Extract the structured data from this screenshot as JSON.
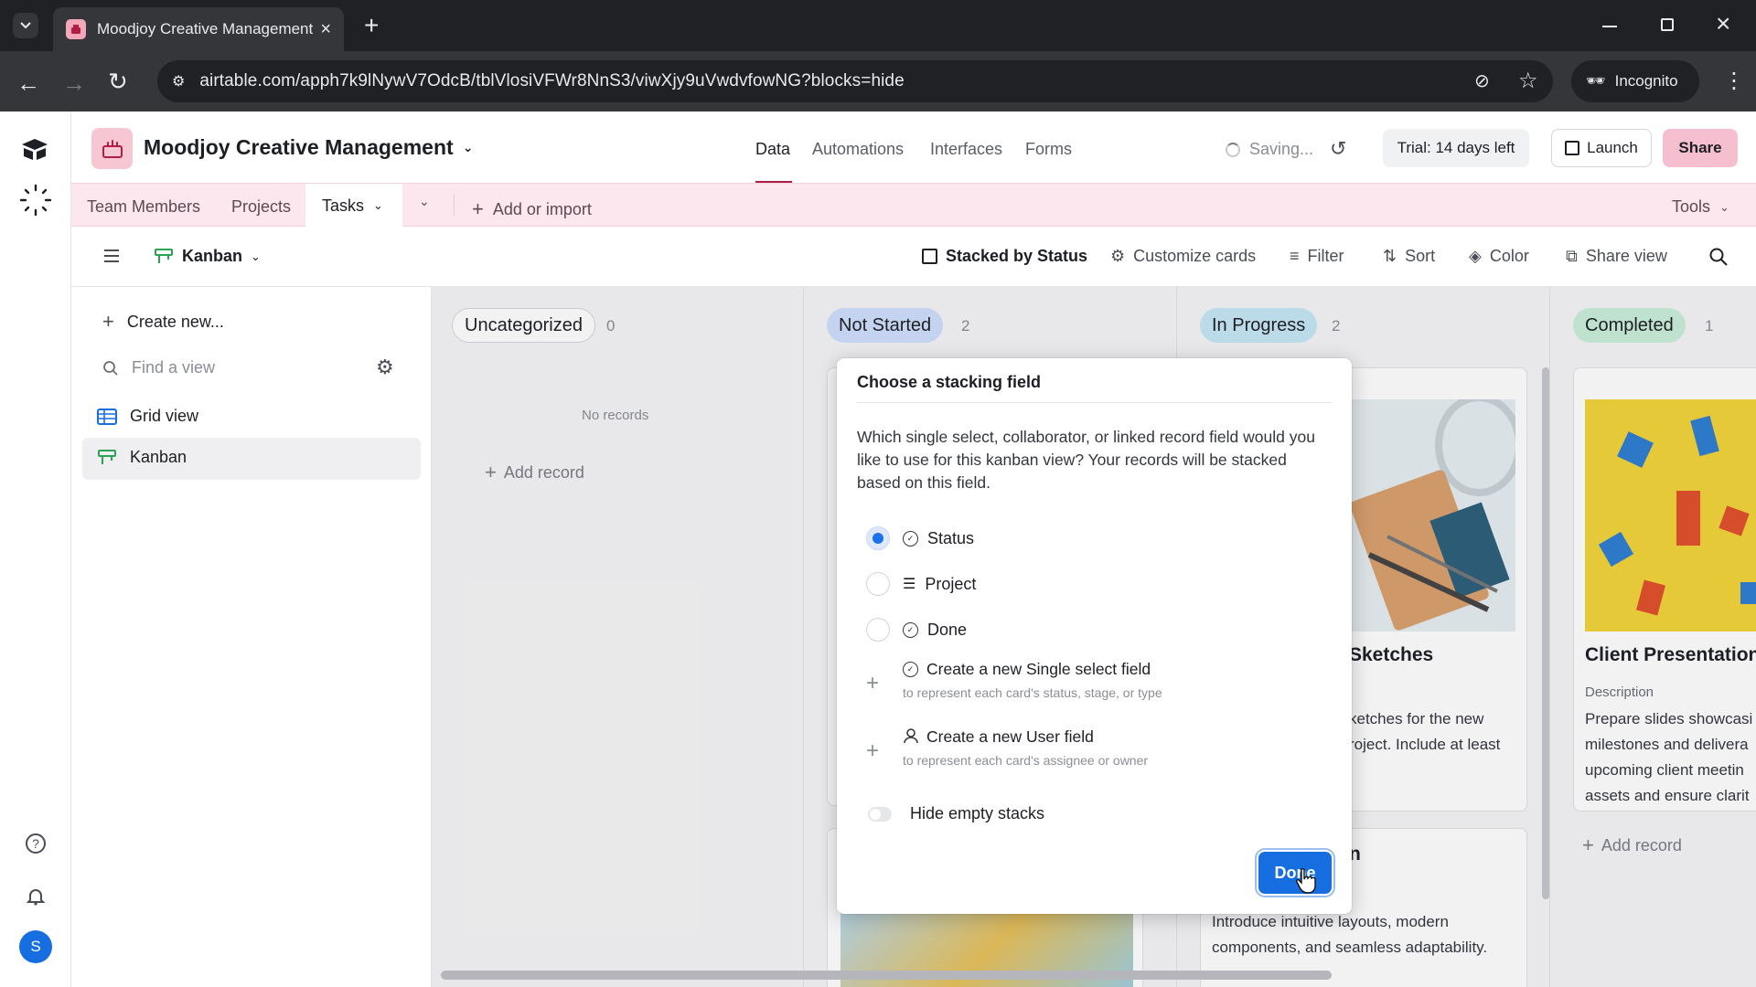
{
  "browser": {
    "tab_title": "Moodjoy Creative Management",
    "url": "airtable.com/apph7k9lNywV7OdcB/tblVlosiVFWr8NnS3/viwXjy9uVwdvfowNG?blocks=hide",
    "incognito_label": "Incognito"
  },
  "header": {
    "base_name": "Moodjoy Creative Management",
    "nav": [
      "Data",
      "Automations",
      "Interfaces",
      "Forms"
    ],
    "active_nav": "Data",
    "saving": "Saving...",
    "trial": "Trial: 14 days left",
    "launch": "Launch",
    "share": "Share"
  },
  "tables": {
    "items": [
      "Team Members",
      "Projects",
      "Tasks"
    ],
    "active": "Tasks",
    "add_or_import": "Add or import",
    "tools": "Tools"
  },
  "viewbar": {
    "view_name": "Kanban",
    "stacked_by": "Stacked by Status",
    "customize": "Customize cards",
    "filter": "Filter",
    "sort": "Sort",
    "color": "Color",
    "share_view": "Share view"
  },
  "sidebar": {
    "create_new": "Create new...",
    "find_placeholder": "Find a view",
    "views": [
      "Grid view",
      "Kanban"
    ],
    "active_view": "Kanban",
    "avatar_initial": "S"
  },
  "board": {
    "stacks": [
      {
        "name": "Uncategorized",
        "count": "0",
        "color": "#ffffff"
      },
      {
        "name": "Not Started",
        "count": "2",
        "color": "#cfe0fc"
      },
      {
        "name": "In Progress",
        "count": "2",
        "color": "#c5e7f5"
      },
      {
        "name": "Completed",
        "count": "1",
        "color": "#c9efd8"
      }
    ],
    "no_records": "No records",
    "add_record": "Add record",
    "cards": {
      "in_progress_1_title": "Sketches",
      "in_progress_1_text": "ketches for the new roject. Include at least",
      "in_progress_2_title": "n",
      "in_progress_2_text": "Introduce intuitive layouts, modern components, and seamless adaptability.",
      "completed_title": "Client Presentation",
      "completed_label": "Description",
      "completed_text": "Prepare slides showcasi milestones and delivera upcoming client meetin assets and ensure clarit"
    }
  },
  "popover": {
    "title": "Choose a stacking field",
    "description": "Which single select, collaborator, or linked record field would you like to use for this kanban view? Your records will be stacked based on this field.",
    "options": [
      "Status",
      "Project",
      "Done"
    ],
    "selected": "Status",
    "create_single_select": "Create a new Single select field",
    "create_single_select_sub": "to represent each card's status, stage, or type",
    "create_user": "Create a new User field",
    "create_user_sub": "to represent each card's assignee or owner",
    "hide_empty": "Hide empty stacks",
    "done_button": "Done"
  },
  "colors": {
    "brand_pink": "#f6bfd0",
    "table_bar": "#fde7ef",
    "primary_blue": "#166ee1"
  }
}
